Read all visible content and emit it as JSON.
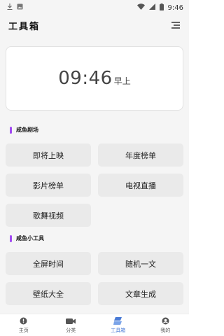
{
  "status_bar": {
    "time": "9:46",
    "left_icons": [
      "download-icon",
      "image-icon"
    ],
    "right_icons": [
      "wifi-icon",
      "signal-icon",
      "battery-icon"
    ]
  },
  "header": {
    "title": "工具箱",
    "menu_icon": "menu-icon"
  },
  "clock": {
    "time": "09:46",
    "period": "早上"
  },
  "sections": [
    {
      "title": "咸鱼剧场",
      "items": [
        "即将上映",
        "年度榜单",
        "影片榜单",
        "电视直播",
        "歌舞视频"
      ]
    },
    {
      "title": "咸鱼小工具",
      "items": [
        "全屏时间",
        "随机一文",
        "壁纸大全",
        "文章生成"
      ]
    }
  ],
  "tabbar": {
    "tabs": [
      {
        "label": "主页",
        "icon": "home-icon",
        "active": false
      },
      {
        "label": "分类",
        "icon": "video-icon",
        "active": false
      },
      {
        "label": "工具箱",
        "icon": "toolbox-icon",
        "active": true
      },
      {
        "label": "我的",
        "icon": "profile-icon",
        "active": false
      }
    ]
  },
  "colors": {
    "accent": "#a24bf2",
    "active_tab": "#4a7bd6",
    "background": "#f5f5f5",
    "button": "#eaeaea"
  }
}
